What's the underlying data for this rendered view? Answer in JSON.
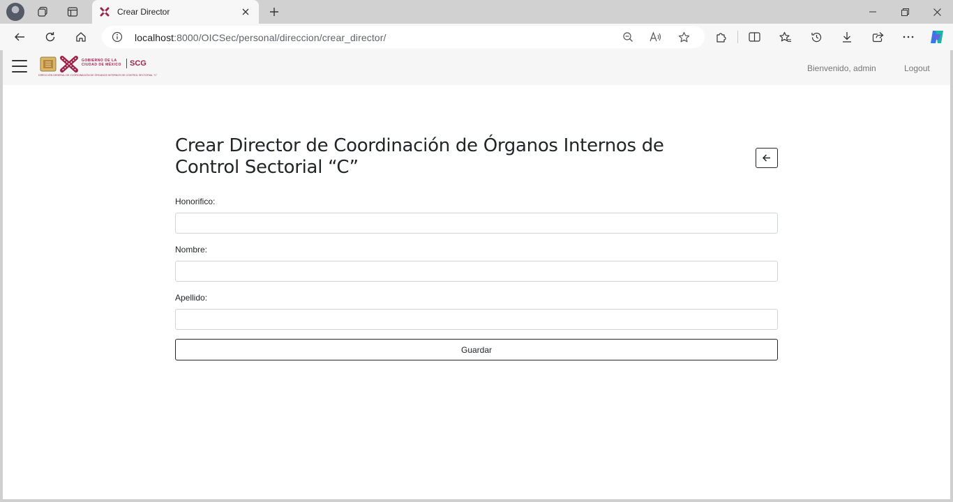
{
  "browser": {
    "tab_title": "Crear Director",
    "url_host": "localhost",
    "url_rest": ":8000/OICSec/personal/direccion/crear_director/"
  },
  "navbar": {
    "logo_line1": "GOBIERNO DE LA",
    "logo_line2": "CIUDAD DE MÉXICO",
    "logo_scg": "SCG",
    "logo_subtitle": "DIRECCIÓN GENERAL DE COORDINACIÓN DE ÓRGANOS INTERNOS DE CONTROL SECTORIAL \"C\"",
    "welcome_text": "Bienvenido,  admin",
    "logout_label": "Logout"
  },
  "form": {
    "heading": "Crear Director de Coordinación de Órganos Internos de Control Sectorial “C”",
    "fields": [
      {
        "label": "Honorifico:",
        "value": ""
      },
      {
        "label": "Nombre:",
        "value": ""
      },
      {
        "label": "Apellido:",
        "value": ""
      }
    ],
    "submit_label": "Guardar"
  },
  "colors": {
    "brand": "#9d2449",
    "text": "#212529",
    "navbar_bg": "#f6f6f6"
  },
  "icons": {
    "back": "arrow-left-icon",
    "menu": "hamburger-menu-icon"
  }
}
